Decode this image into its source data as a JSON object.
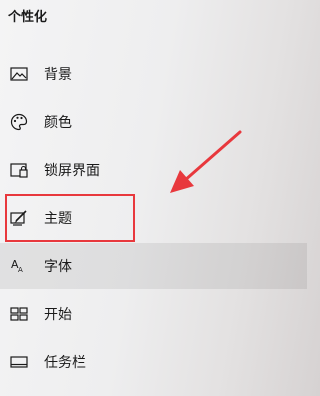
{
  "header": {
    "title": "个性化"
  },
  "nav": {
    "items": [
      {
        "label": "背景",
        "icon": "picture-icon"
      },
      {
        "label": "颜色",
        "icon": "palette-icon"
      },
      {
        "label": "锁屏界面",
        "icon": "lock-screen-icon"
      },
      {
        "label": "主题",
        "icon": "theme-brush-icon"
      },
      {
        "label": "字体",
        "icon": "font-icon"
      },
      {
        "label": "开始",
        "icon": "start-tiles-icon"
      },
      {
        "label": "任务栏",
        "icon": "taskbar-icon"
      }
    ]
  },
  "colors": {
    "annotation_red": "#e8383d",
    "text": "#1a1a1a"
  },
  "icon_glyphs": {
    "font_icon_text": "A"
  }
}
